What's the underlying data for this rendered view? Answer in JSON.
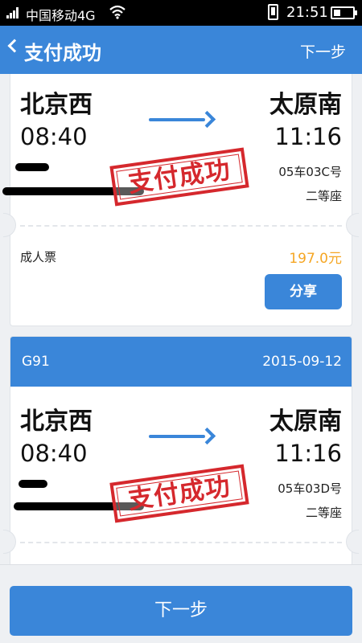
{
  "status_bar": {
    "carrier": "中国移动4G",
    "time": "21:51"
  },
  "title_bar": {
    "back_icon": "chevron-left-icon",
    "title": "支付成功",
    "next": "下一步"
  },
  "tickets": [
    {
      "from": "北京西",
      "to": "太原南",
      "depart_time": "08:40",
      "arrive_time": "11:16",
      "seat": "05车03C号",
      "seat_class": "二等座",
      "stamp": "支付成功",
      "ticket_type": "成人票",
      "price": "197.0元",
      "share": "分享"
    },
    {
      "train": "G91",
      "date": "2015-09-12",
      "from": "北京西",
      "to": "太原南",
      "depart_time": "08:40",
      "arrive_time": "11:16",
      "seat": "05车03D号",
      "seat_class": "二等座",
      "stamp": "支付成功"
    }
  ],
  "bottom": {
    "button": "下一步"
  },
  "colors": {
    "primary": "#3a86d9",
    "price": "#f5a623",
    "stamp": "#d5282d"
  }
}
